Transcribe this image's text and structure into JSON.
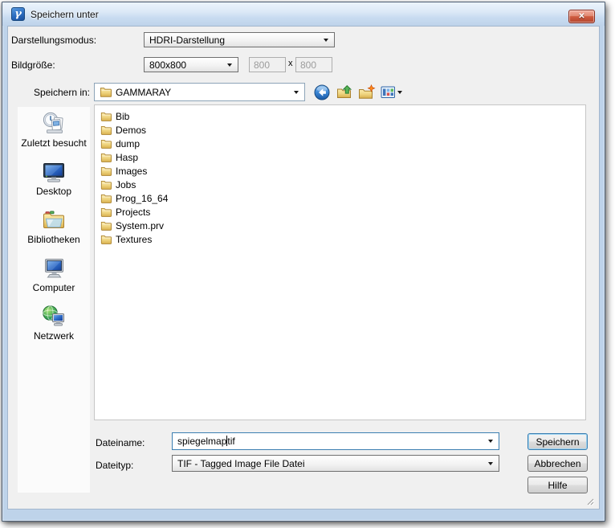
{
  "window": {
    "title": "Speichern unter",
    "app_icon_glyph": "γ",
    "close_glyph": "✕"
  },
  "fields": {
    "display_mode": {
      "label": "Darstellungsmodus:",
      "value": "HDRI-Darstellung"
    },
    "image_size": {
      "label": "Bildgröße:",
      "value": "800x800",
      "width": "800",
      "separator": "x",
      "height": "800"
    },
    "save_in": {
      "label": "Speichern in:",
      "value": "GAMMARAY"
    }
  },
  "toolbar": {
    "back": "navigate-back",
    "up": "up-one-level",
    "new_folder": "create-new-folder",
    "views": "view-menu"
  },
  "places": [
    {
      "label": "Zuletzt besucht",
      "icon": "recent-places-icon"
    },
    {
      "label": "Desktop",
      "icon": "desktop-icon"
    },
    {
      "label": "Bibliotheken",
      "icon": "libraries-icon"
    },
    {
      "label": "Computer",
      "icon": "computer-icon"
    },
    {
      "label": "Netzwerk",
      "icon": "network-icon"
    }
  ],
  "file_list": {
    "folders": [
      "Bib",
      "Demos",
      "dump",
      "Hasp",
      "Images",
      "Jobs",
      "Prog_16_64",
      "Projects",
      "System.prv",
      "Textures"
    ]
  },
  "footer": {
    "filename": {
      "label": "Dateiname:",
      "value": "spiegelmap.tif",
      "before_caret": "spiegelmap",
      "after_caret": "tif"
    },
    "filetype": {
      "label": "Dateityp:",
      "value": "TIF - Tagged Image File Datei"
    },
    "buttons": {
      "save": "Speichern",
      "cancel": "Abbrechen",
      "help": "Hilfe"
    }
  },
  "colors": {
    "titlebar_top": "#ecf4fc",
    "frame_blue": "#bed3ea",
    "client_bg": "#f0f0f0",
    "close_button_red": "#c0442f",
    "default_button_border": "#3c7fb1",
    "folder_yellow": "#edd079",
    "focus_border": "#3c7fb1"
  }
}
